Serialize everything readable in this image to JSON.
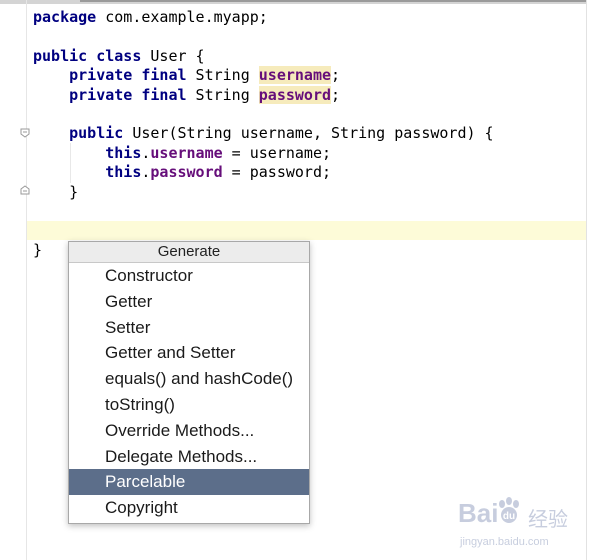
{
  "editor": {
    "code_lines": [
      "package com.example.myapp;",
      "",
      "public class User {",
      "    private final String username;",
      "    private final String password;",
      "",
      "    public User(String username, String password) {",
      "        this.username = username;",
      "        this.password = password;",
      "    }",
      "",
      "",
      "}"
    ]
  },
  "popup": {
    "title": "Generate",
    "items": [
      "Constructor",
      "Getter",
      "Setter",
      "Getter and Setter",
      "equals() and hashCode()",
      "toString()",
      "Override Methods...",
      "Delegate Methods...",
      "Parcelable",
      "Copyright"
    ],
    "selected_item": "Parcelable"
  },
  "watermark": {
    "brand": "Bai",
    "brand2": "经验",
    "url": "jingyan.baidu.com"
  },
  "colors": {
    "keyword": "#000080",
    "field": "#660e7a",
    "usage_highlight": "#f6ebbc",
    "current_line": "#fdfbd8",
    "selection": "#5c6e8a"
  }
}
